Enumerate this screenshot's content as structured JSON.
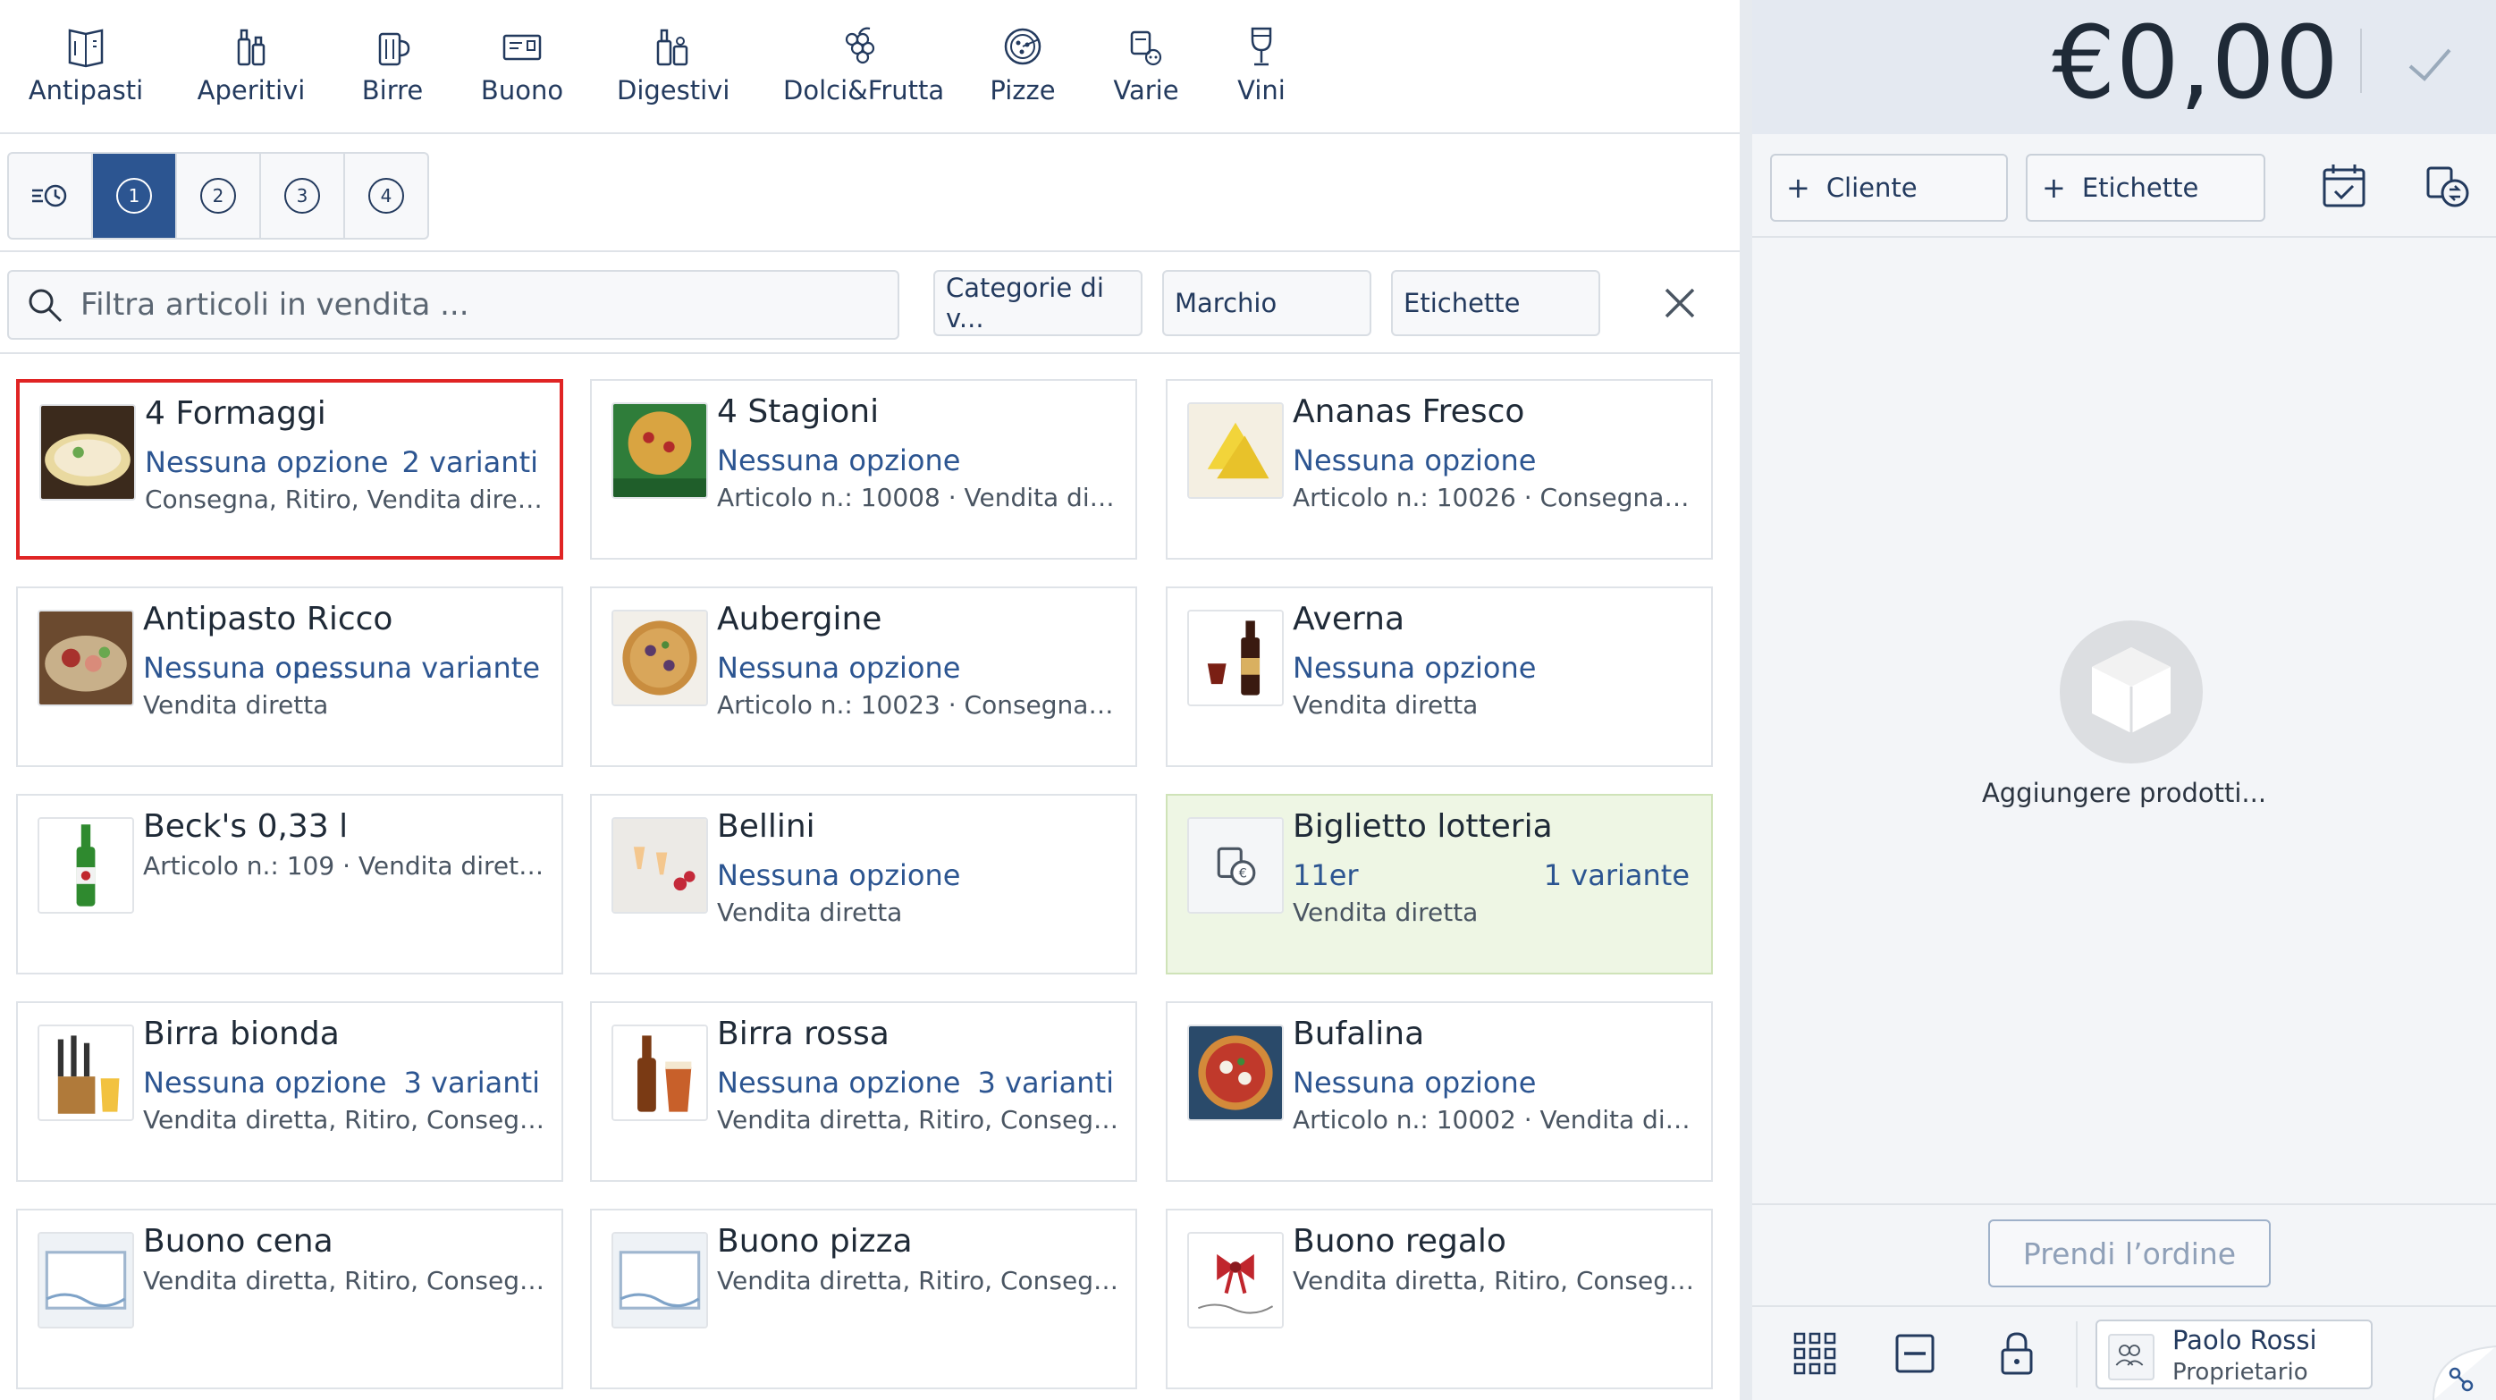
{
  "categories": [
    {
      "label": "Antipasti",
      "icon": "menu-card-icon"
    },
    {
      "label": "Aperitivi",
      "icon": "bottles-icon"
    },
    {
      "label": "Birre",
      "icon": "beer-mug-icon"
    },
    {
      "label": "Buono",
      "icon": "voucher-icon"
    },
    {
      "label": "Digestivi",
      "icon": "liquor-bottles-icon"
    },
    {
      "label": "Dolci&Frutta",
      "icon": "grapes-icon"
    },
    {
      "label": "Pizze",
      "icon": "pizza-icon"
    },
    {
      "label": "Varie",
      "icon": "misc-icon"
    },
    {
      "label": "Vini",
      "icon": "wine-glass-icon"
    }
  ],
  "course_tabs": [
    "1",
    "2",
    "3",
    "4"
  ],
  "active_course": "1",
  "search": {
    "placeholder": "Filtra articoli in vendita ..."
  },
  "filters": {
    "categories": "Categorie di v...",
    "brand": "Marchio",
    "labels": "Etichette"
  },
  "products": [
    {
      "title": "4 Formaggi",
      "option": "Nessuna opzione",
      "variants": "2 varianti",
      "desc": "Consegna, Ritiro, Vendita diretta",
      "selected": true
    },
    {
      "title": "4 Stagioni",
      "option": "Nessuna opzione",
      "variants": "",
      "desc": "Articolo n.: 10008 · Vendita dirett..."
    },
    {
      "title": "Ananas Fresco",
      "option": "Nessuna opzione",
      "variants": "",
      "desc": "Articolo n.: 10026 · Consegna, Rit..."
    },
    {
      "title": "Antipasto Ricco",
      "option": "Nessuna op...",
      "variants": "nessuna variante",
      "desc": "Vendita diretta"
    },
    {
      "title": "Aubergine",
      "option": "Nessuna opzione",
      "variants": "",
      "desc": "Articolo n.: 10023 · Consegna, Rit..."
    },
    {
      "title": "Averna",
      "option": "Nessuna opzione",
      "variants": "",
      "desc": "Vendita diretta"
    },
    {
      "title": "Beck's 0,33 l",
      "option": "",
      "variants": "",
      "desc": "Articolo n.: 109 · Vendita diretta, ..."
    },
    {
      "title": "Bellini",
      "option": "Nessuna opzione",
      "variants": "",
      "desc": "Vendita diretta"
    },
    {
      "title": "Biglietto lotteria",
      "option": "11er",
      "variants": "1 variante",
      "desc": "Vendita diretta",
      "highlight": true
    },
    {
      "title": "Birra bionda",
      "option": "Nessuna opzione",
      "variants": "3 varianti",
      "desc": "Vendita diretta, Ritiro, Consegna"
    },
    {
      "title": "Birra rossa",
      "option": "Nessuna opzione",
      "variants": "3 varianti",
      "desc": "Vendita diretta, Ritiro, Consegna"
    },
    {
      "title": "Bufalina",
      "option": "Nessuna opzione",
      "variants": "",
      "desc": "Articolo n.: 10002 · Vendita dirett..."
    },
    {
      "title": "Buono cena",
      "option": "",
      "variants": "",
      "desc": "Vendita diretta, Ritiro, Consegna"
    },
    {
      "title": "Buono pizza",
      "option": "",
      "variants": "",
      "desc": "Vendita diretta, Ritiro, Consegna"
    },
    {
      "title": "Buono regalo",
      "option": "",
      "variants": "",
      "desc": "Vendita diretta, Ritiro, Consegna"
    }
  ],
  "cart": {
    "total": "€0,00",
    "customer_button": "Cliente",
    "labels_button": "Etichette",
    "empty_text": "Aggiungere prodotti...",
    "take_order": "Prendi l’ordine"
  },
  "user": {
    "name": "Paolo Rossi",
    "role": "Proprietario"
  },
  "colors": {
    "accent": "#2c5591",
    "selection": "#e02424",
    "highlight_bg": "#eef6e4"
  }
}
